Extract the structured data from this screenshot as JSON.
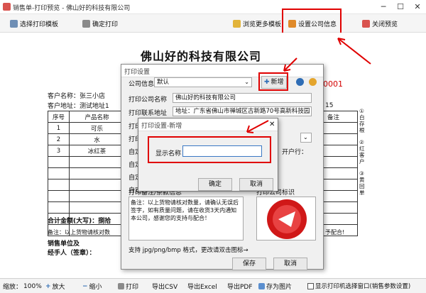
{
  "window": {
    "title": "销售单-打印预览 - 佛山好的科技有限公司"
  },
  "toolbar": {
    "select_template": "选择打印模板",
    "confirm_print": "确定打印",
    "browse_templates": "浏览更多模板",
    "company_settings": "设置公司信息",
    "close_preview": "关闭预览"
  },
  "document": {
    "company": "佛山好的科技有限公司",
    "order_no_fragment": "0001",
    "customer": "客户名称：张三小店",
    "address": "客户地址：测试地址1",
    "date_fragment": "15",
    "headers": [
      "序号",
      "产品名称",
      "备注"
    ],
    "rows": [
      [
        "1",
        "可乐"
      ],
      [
        "2",
        "水"
      ],
      [
        "3",
        "冰红茶"
      ]
    ],
    "side_notes": [
      "①白存根",
      "②红客户",
      "③黄回单"
    ],
    "total_label": "合计金额(大写)：捌拾",
    "note_fragment": "备注：以上货物请核对数",
    "note_end": "予配合!",
    "sales_unit": "销售单位及",
    "handler": "经手人（签章）："
  },
  "dialog": {
    "title": "打印设置",
    "company_info_label": "公司信息",
    "company_info_value": "默认",
    "add_new": "新增",
    "print_company_label": "打印公司名称",
    "print_company_value": "佛山好的科技有限公司",
    "print_address_label": "打印联系地址",
    "print_address_value": "地址：广东省佛山市禅城区古新路70号高新科技园",
    "label_4": "打印",
    "label_5": "打印",
    "label_6": "自定",
    "label_7": "自定",
    "label_8": "自定",
    "label_9": "自定",
    "bank_fragment": "开户行：",
    "notes_label": "打印备注/条款信息",
    "logo_label": "打印公司标识",
    "notes_text": "备注：以上货物请核对数量，请确认无误后签字，如有质量问题，请在收货3天内通知本公司，感谢您的支持与配合！",
    "image_hint": "支持 jpg/png/bmp 格式，更改请双击图标→",
    "save": "保存",
    "cancel": "取消"
  },
  "subdialog": {
    "title": "打印设置-新增",
    "display_name_label": "显示名称",
    "display_name_value": "",
    "ok": "确定",
    "cancel": "取消"
  },
  "statusbar": {
    "zoom_label": "缩放：",
    "zoom_value": "100%",
    "zoom_in": "放大",
    "zoom_out": "缩小",
    "print": "打印",
    "export_csv": "导出CSV",
    "export_excel": "导出Excel",
    "export_pdf": "导出PDF",
    "save_image": "存为图片",
    "show_printer_window": "显示打印机选择窗口(销售参数设置)"
  },
  "colors": {
    "highlight": "#e00000",
    "accent_blue": "#2f6db5",
    "order_red": "#d40000"
  }
}
